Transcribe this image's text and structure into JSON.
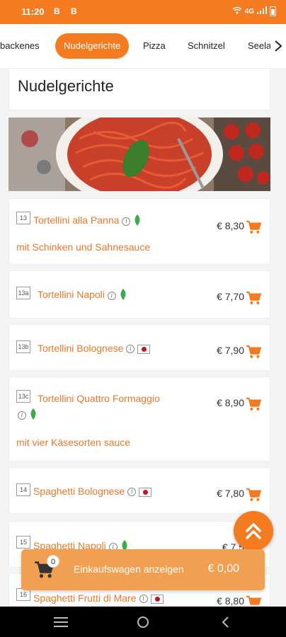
{
  "status_bar": {
    "time": "11:20",
    "left_icons": "B B",
    "network": "4G"
  },
  "tabs": [
    {
      "label": "backenes",
      "active": false
    },
    {
      "label": "Nudelgerichte",
      "active": true
    },
    {
      "label": "Pizza",
      "active": false
    },
    {
      "label": "Schnitzel",
      "active": false
    },
    {
      "label": "Seela",
      "active": false
    }
  ],
  "section": {
    "title": "Nudelgerichte"
  },
  "items": [
    {
      "number": "13",
      "name": "Tortellini alla Panna",
      "description": "mit Schinken und Sahnesauce",
      "price": "€ 8,30",
      "badge": "leaf"
    },
    {
      "number": "13a",
      "name": "Tortellini Napoli",
      "description": "",
      "price": "€ 7,70",
      "badge": "leaf"
    },
    {
      "number": "13b",
      "name": "Tortellini Bolognese",
      "description": "",
      "price": "€ 7,90",
      "badge": "flag"
    },
    {
      "number": "13c",
      "name": "Tortellini Quattro Formaggio",
      "description": "mit vier Käsesorten sauce",
      "price": "€ 8,90",
      "badge": "leaf"
    },
    {
      "number": "14",
      "name": "Spaghetti Bolognese",
      "description": "",
      "price": "€ 7,80",
      "badge": "flag"
    },
    {
      "number": "15",
      "name": "Spaghetti Napoli",
      "description": "",
      "price": "€ 7,5",
      "badge": "leaf"
    },
    {
      "number": "16",
      "name": "Spaghetti Frutti di Mare",
      "description": "",
      "price": "€ 8,80",
      "badge": "flag"
    }
  ],
  "cart": {
    "count": "0",
    "label": "Einkaufswagen anzeigen",
    "total": "€ 0,00"
  },
  "colors": {
    "accent": "#f47b20",
    "item_text": "#e8782a",
    "cart_bar": "#f0a050"
  },
  "icons": {
    "info": "i"
  }
}
